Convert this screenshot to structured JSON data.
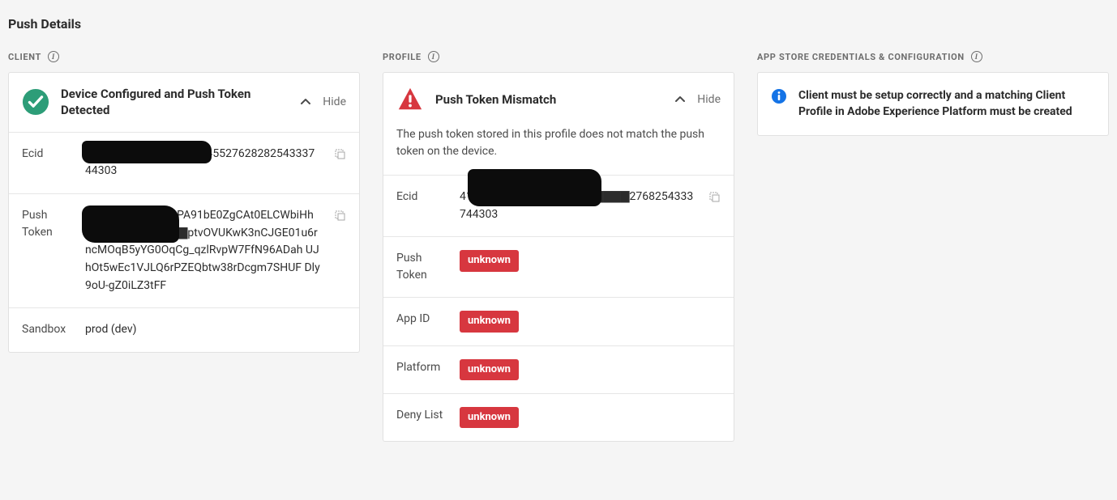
{
  "page_title": "Push Details",
  "client": {
    "label": "CLIENT",
    "status_title": "Device Configured and Push Token Detected",
    "hide": "Hide",
    "rows": {
      "ecid": {
        "label": "Ecid",
        "value": "41423094213383742444552762828254333744303"
      },
      "push_token": {
        "label": "Push Token",
        "value": "dg▇▇▇KGUSPA:APA91bE0ZgCAt0ELCWbiHh o▇▇▇▇▇▇▇▇▇▇▇ptvOVUKwK3nCJGE01u6r ncMOqB5yYG0OqCg_qzlRvpW7FfN96ADah UJhOt5wEc1VJLQ6rPZEQbtw38rDcgm7SHUF Dly9oU-gZ0iLZ3tFF"
      },
      "sandbox": {
        "label": "Sandbox",
        "value": "prod (dev)"
      }
    }
  },
  "profile": {
    "label": "PROFILE",
    "status_title": "Push Token Mismatch",
    "description": "The push token stored in this profile does not match the push token on the device.",
    "hide": "Hide",
    "rows": {
      "ecid": {
        "label": "Ecid",
        "value": "41▇▇▇▇▇▇▇▇▇▇▇▇▇▇▇▇▇▇2768254333744303"
      },
      "push_token": {
        "label": "Push Token",
        "badge": "unknown"
      },
      "app_id": {
        "label": "App ID",
        "badge": "unknown"
      },
      "platform": {
        "label": "Platform",
        "badge": "unknown"
      },
      "deny_list": {
        "label": "Deny List",
        "badge": "unknown"
      }
    }
  },
  "app_store": {
    "label": "APP STORE CREDENTIALS & CONFIGURATION",
    "message": "Client must be setup correctly and a matching Client Profile in Adobe Experience Platform must be created"
  }
}
